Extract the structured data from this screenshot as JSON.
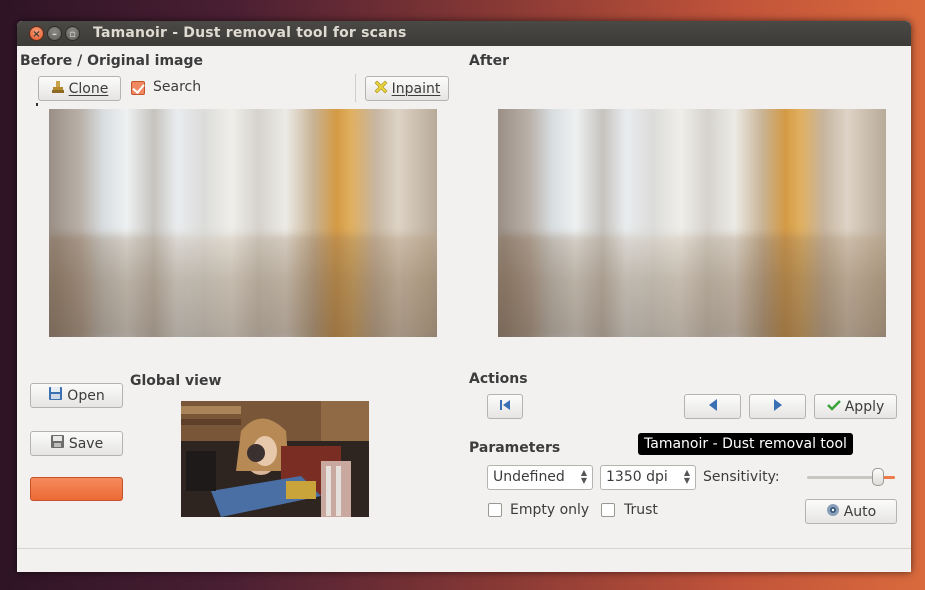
{
  "window": {
    "title": "Tamanoir - Dust removal tool for scans"
  },
  "before_panel": {
    "title": "Before / Original image",
    "clone_label": "Clone",
    "search_label": "Search",
    "search_checked": true,
    "inpaint_label": "Inpaint"
  },
  "after_panel": {
    "title": "After"
  },
  "file_buttons": {
    "open_label": "Open",
    "save_label": "Save"
  },
  "global_view": {
    "title": "Global view"
  },
  "actions": {
    "title": "Actions",
    "apply_label": "Apply"
  },
  "tooltip": {
    "text": "Tamanoir - Dust removal tool"
  },
  "parameters": {
    "title": "Parameters",
    "film_type": "Undefined",
    "resolution": "1350 dpi",
    "sensitivity_label": "Sensitivity:",
    "sensitivity_level": 0.85,
    "empty_only_label": "Empty only",
    "empty_only_checked": false,
    "trust_label": "Trust",
    "trust_checked": false,
    "auto_label": "Auto"
  },
  "colors": {
    "accent": "#ef7a4a",
    "window_bg": "#f2f1f0",
    "titlebar": "#3c3b37",
    "tooltip_bg": "#000000"
  },
  "icons": {
    "clone": "stamp-icon",
    "inpaint": "star-patch-icon",
    "open": "floppy-icon",
    "save": "save-disk-icon",
    "first": "skip-first-icon",
    "prev": "triangle-left-icon",
    "next": "triangle-right-icon",
    "apply": "checkmark-icon",
    "auto": "auto-gear-icon"
  }
}
